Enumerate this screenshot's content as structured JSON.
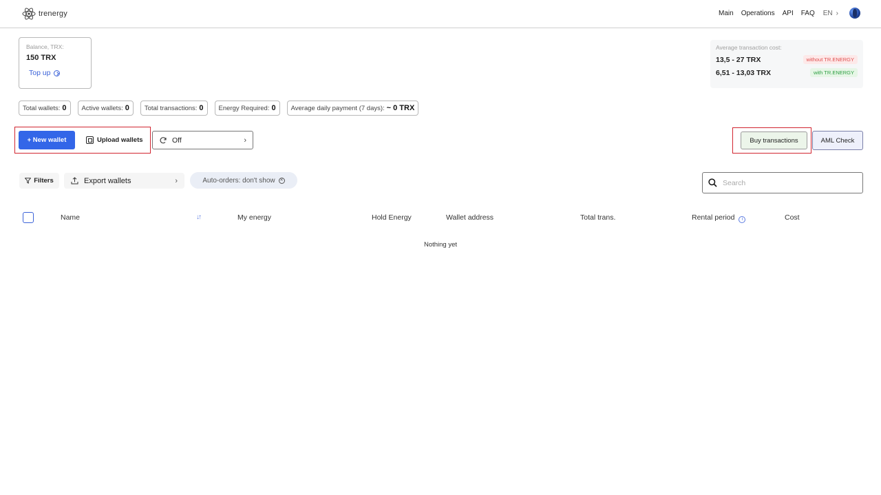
{
  "header": {
    "logo_text": "trenergy",
    "nav": {
      "main": "Main",
      "operations": "Operations",
      "api": "API",
      "faq": "FAQ",
      "lang": "EN",
      "lang_chevron": "›"
    }
  },
  "balance": {
    "label": "Balance, TRX:",
    "value": "150 TRX",
    "topup_label": "Top up"
  },
  "avg_cost": {
    "label": "Average transaction cost:",
    "rows": [
      {
        "value": "13,5 - 27 TRX",
        "badge": "without TR.ENERGY"
      },
      {
        "value": "6,51 - 13,03 TRX",
        "badge": "with TR.ENERGY"
      }
    ],
    "colors": {
      "without": "#e05050",
      "with": "#2f9f44"
    }
  },
  "stats": [
    {
      "label": "Total wallets:",
      "value": "0"
    },
    {
      "label": "Active wallets:",
      "value": "0"
    },
    {
      "label": "Total transactions:",
      "value": "0"
    },
    {
      "label": "Energy Required:",
      "value": "0"
    },
    {
      "label": "Average daily payment (7 days):",
      "value": "~ 0 TRX"
    }
  ],
  "actions": {
    "new_wallet": "+ New wallet",
    "upload_wallets": "Upload wallets",
    "auto_mode": "Off",
    "buy_transactions": "Buy transactions",
    "aml_check": "AML Check"
  },
  "filters": {
    "filters_label": "Filters",
    "export_label": "Export wallets",
    "auto_orders_label": "Auto-orders: don't show"
  },
  "search": {
    "placeholder": "Search",
    "value": ""
  },
  "table": {
    "columns": {
      "name": "Name",
      "my_energy": "My energy",
      "hold_energy": "Hold Energy",
      "wallet_address": "Wallet address",
      "total_trans": "Total trans.",
      "rental_period": "Rental period",
      "cost": "Cost"
    },
    "empty_text": "Nothing yet"
  },
  "accent_color": "#3366e8",
  "highlight_color": "#d1242f"
}
